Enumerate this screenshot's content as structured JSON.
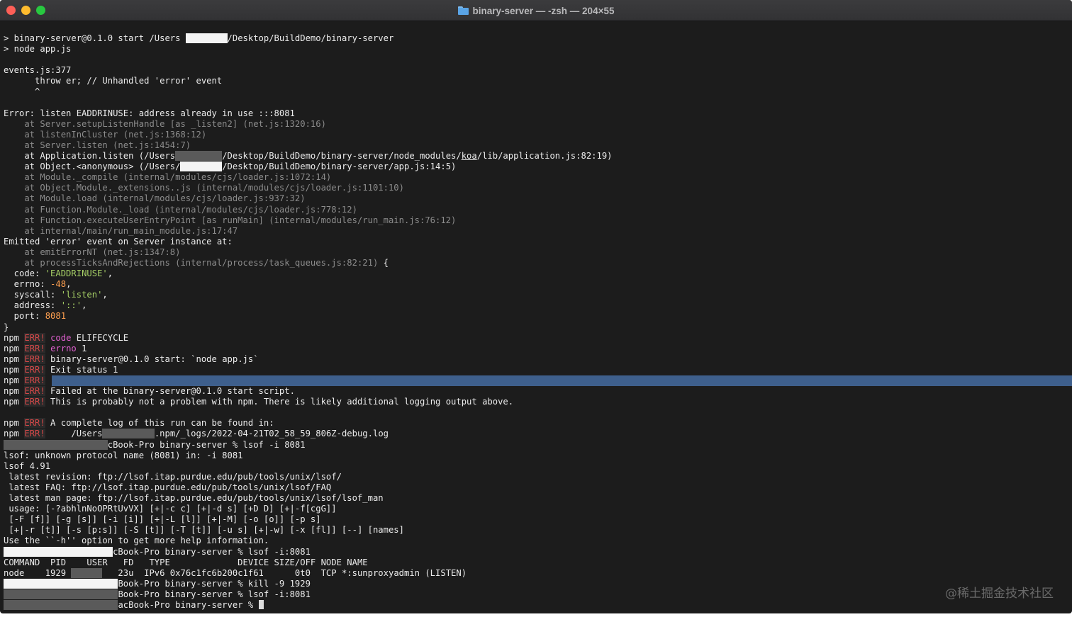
{
  "window": {
    "title": "binary-server — -zsh — 204×55"
  },
  "terminal": {
    "lines": [
      {
        "segments": [
          {
            "t": "> binary-server@0.1.0 start /Users "
          },
          {
            "t": "        ",
            "redact": true
          },
          {
            "t": "/Desktop/BuildDemo/binary-server"
          }
        ]
      },
      {
        "segments": [
          {
            "t": "> node app.js"
          }
        ]
      },
      {
        "segments": [
          {
            "t": ""
          }
        ]
      },
      {
        "segments": [
          {
            "t": "events.js:377"
          }
        ]
      },
      {
        "segments": [
          {
            "t": "      throw er; // Unhandled 'error' event"
          }
        ]
      },
      {
        "segments": [
          {
            "t": "      ^"
          }
        ]
      },
      {
        "segments": [
          {
            "t": ""
          }
        ]
      },
      {
        "segments": [
          {
            "t": "Error: listen EADDRINUSE: address already in use :::8081"
          }
        ]
      },
      {
        "segments": [
          {
            "t": "    at Server.setupListenHandle [as _listen2] (net.js:1320:16)",
            "c": "g"
          }
        ]
      },
      {
        "segments": [
          {
            "t": "    at listenInCluster (net.js:1368:12)",
            "c": "g"
          }
        ]
      },
      {
        "segments": [
          {
            "t": "    at Server.listen (net.js:1454:7)",
            "c": "g"
          }
        ]
      },
      {
        "segments": [
          {
            "t": "    at Application.listen (/Users"
          },
          {
            "t": "         ",
            "redact": true
          },
          {
            "t": "/Desktop/BuildDemo/binary-server/node_modules/"
          },
          {
            "t": "koa",
            "c": "u"
          },
          {
            "t": "/lib/application.js:82:19)"
          }
        ]
      },
      {
        "segments": [
          {
            "t": "    at Object.<anonymous> (/Users/"
          },
          {
            "t": "        ",
            "redact": true
          },
          {
            "t": "/Desktop/BuildDemo/binary-server/app.js:14:5)"
          }
        ]
      },
      {
        "segments": [
          {
            "t": "    at Module._compile (internal/modules/cjs/loader.js:1072:14)",
            "c": "g"
          }
        ]
      },
      {
        "segments": [
          {
            "t": "    at Object.Module._extensions..js (internal/modules/cjs/loader.js:1101:10)",
            "c": "g"
          }
        ]
      },
      {
        "segments": [
          {
            "t": "    at Module.load (internal/modules/cjs/loader.js:937:32)",
            "c": "g"
          }
        ]
      },
      {
        "segments": [
          {
            "t": "    at Function.Module._load (internal/modules/cjs/loader.js:778:12)",
            "c": "g"
          }
        ]
      },
      {
        "segments": [
          {
            "t": "    at Function.executeUserEntryPoint [as runMain] (internal/modules/run_main.js:76:12)",
            "c": "g"
          }
        ]
      },
      {
        "segments": [
          {
            "t": "    at internal/main/run_main_module.js:17:47",
            "c": "g"
          }
        ]
      },
      {
        "segments": [
          {
            "t": "Emitted 'error' event on Server instance at:"
          }
        ]
      },
      {
        "segments": [
          {
            "t": "    at emitErrorNT (net.js:1347:8)",
            "c": "g"
          }
        ]
      },
      {
        "segments": [
          {
            "t": "    at processTicksAndRejections (internal/process/task_queues.js:82:21)",
            "c": "g"
          },
          {
            "t": " {"
          }
        ]
      },
      {
        "segments": [
          {
            "t": "  code: "
          },
          {
            "t": "'EADDRINUSE'",
            "c": "grn"
          },
          {
            "t": ","
          }
        ]
      },
      {
        "segments": [
          {
            "t": "  errno: "
          },
          {
            "t": "-48",
            "c": "org"
          },
          {
            "t": ","
          }
        ]
      },
      {
        "segments": [
          {
            "t": "  syscall: "
          },
          {
            "t": "'listen'",
            "c": "grn"
          },
          {
            "t": ","
          }
        ]
      },
      {
        "segments": [
          {
            "t": "  address: "
          },
          {
            "t": "'::'",
            "c": "grn"
          },
          {
            "t": ","
          }
        ]
      },
      {
        "segments": [
          {
            "t": "  port: "
          },
          {
            "t": "8081",
            "c": "org"
          }
        ]
      },
      {
        "segments": [
          {
            "t": "}"
          }
        ]
      },
      {
        "segments": [
          {
            "t": "npm "
          },
          {
            "t": "ERR!",
            "c": "err"
          },
          {
            "t": " "
          },
          {
            "t": "code",
            "c": "mag"
          },
          {
            "t": " ELIFECYCLE"
          }
        ]
      },
      {
        "segments": [
          {
            "t": "npm "
          },
          {
            "t": "ERR!",
            "c": "err"
          },
          {
            "t": " "
          },
          {
            "t": "errno",
            "c": "mag"
          },
          {
            "t": " 1"
          }
        ]
      },
      {
        "segments": [
          {
            "t": "npm "
          },
          {
            "t": "ERR!",
            "c": "err"
          },
          {
            "t": " binary-server@0.1.0 start: `node app.js`"
          }
        ]
      },
      {
        "segments": [
          {
            "t": "npm "
          },
          {
            "t": "ERR!",
            "c": "err"
          },
          {
            "t": " Exit status 1"
          }
        ]
      },
      {
        "segments": [
          {
            "t": "npm "
          },
          {
            "t": "ERR!",
            "c": "err"
          }
        ],
        "highlight": true
      },
      {
        "segments": [
          {
            "t": "npm "
          },
          {
            "t": "ERR!",
            "c": "err"
          },
          {
            "t": " Failed at the binary-server@0.1.0 start script."
          }
        ]
      },
      {
        "segments": [
          {
            "t": "npm "
          },
          {
            "t": "ERR!",
            "c": "err"
          },
          {
            "t": " This is probably not a problem with npm. There is likely additional logging output above."
          }
        ]
      },
      {
        "segments": [
          {
            "t": ""
          }
        ]
      },
      {
        "segments": [
          {
            "t": "npm "
          },
          {
            "t": "ERR!",
            "c": "err"
          },
          {
            "t": " A complete log of this run can be found in:"
          }
        ]
      },
      {
        "segments": [
          {
            "t": "npm "
          },
          {
            "t": "ERR!",
            "c": "err"
          },
          {
            "t": "     /Users"
          },
          {
            "t": "          ",
            "redact": true
          },
          {
            "t": ".npm/_logs/2022-04-21T02_58_59_806Z-debug.log"
          }
        ]
      },
      {
        "segments": [
          {
            "t": "                    ",
            "redact": true
          },
          {
            "t": "cBook-Pro binary-server % lsof -i 8081"
          }
        ]
      },
      {
        "segments": [
          {
            "t": "lsof: unknown protocol name (8081) in: -i 8081"
          }
        ]
      },
      {
        "segments": [
          {
            "t": "lsof 4.91"
          }
        ]
      },
      {
        "segments": [
          {
            "t": " latest revision: ftp://lsof.itap.purdue.edu/pub/tools/unix/lsof/"
          }
        ]
      },
      {
        "segments": [
          {
            "t": " latest FAQ: ftp://lsof.itap.purdue.edu/pub/tools/unix/lsof/FAQ"
          }
        ]
      },
      {
        "segments": [
          {
            "t": " latest man page: ftp://lsof.itap.purdue.edu/pub/tools/unix/lsof/lsof_man"
          }
        ]
      },
      {
        "segments": [
          {
            "t": " usage: [-?abhlnNoOPRtUvVX] [+|-c c] [+|-d s] [+D D] [+|-f[cgG]]"
          }
        ]
      },
      {
        "segments": [
          {
            "t": " [-F [f]] [-g [s]] [-i [i]] [+|-L [l]] [+|-M] [-o [o]] [-p s]"
          }
        ]
      },
      {
        "segments": [
          {
            "t": " [+|-r [t]] [-s [p:s]] [-S [t]] [-T [t]] [-u s] [+|-w] [-x [fl]] [--] [names]"
          }
        ]
      },
      {
        "segments": [
          {
            "t": "Use the ``-h'' option to get more help information."
          }
        ]
      },
      {
        "segments": [
          {
            "t": "                     ",
            "redact": true
          },
          {
            "t": "cBook-Pro binary-server % lsof -i:8081"
          }
        ]
      },
      {
        "segments": [
          {
            "t": "COMMAND  PID    USER   FD   TYPE             DEVICE SIZE/OFF NODE NAME"
          }
        ]
      },
      {
        "segments": [
          {
            "t": "node    1929 "
          },
          {
            "t": "      ",
            "redact": true
          },
          {
            "t": "   23u  IPv6 0x76c1fc6b200c1f61      0t0  TCP *:sunproxyadmin (LISTEN)"
          }
        ]
      },
      {
        "segments": [
          {
            "t": "                      ",
            "redact": true
          },
          {
            "t": "Book-Pro binary-server % kill -9 1929"
          }
        ]
      },
      {
        "segments": [
          {
            "t": "                      ",
            "redact": true
          },
          {
            "t": "Book-Pro binary-server % lsof -i:8081"
          }
        ]
      },
      {
        "segments": [
          {
            "t": "                      ",
            "redact": true
          },
          {
            "t": "acBook-Pro binary-server % "
          }
        ],
        "cursor": true
      }
    ]
  },
  "watermark": "@稀土掘金技术社区"
}
